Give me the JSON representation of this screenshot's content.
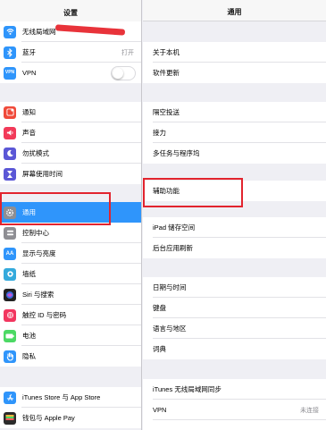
{
  "colors": {
    "accent": "#2f95fb",
    "annotation": "#e2242e",
    "wifi": "#2f95fb",
    "bluetooth": "#2f95fb",
    "vpn": "#2f95fb",
    "notifications": "#f04a3a",
    "sounds": "#f23a59",
    "dnd": "#5b57d6",
    "screen_time": "#5b57d6",
    "general": "#8e8e93",
    "control_center": "#8e8e93",
    "display": "#2f95fb",
    "wallpaper": "#34aadc",
    "siri": "#222222",
    "touchid": "#f2365f",
    "battery": "#4cd964",
    "privacy": "#2f95fb",
    "appstore": "#2f95fb",
    "wallet": "#2b2b2b"
  },
  "left": {
    "title": "设置",
    "items": [
      {
        "label": "无线局域网",
        "icon": "wifi-icon",
        "value": ""
      },
      {
        "label": "蓝牙",
        "icon": "bluetooth-icon",
        "value": "打开"
      },
      {
        "label": "VPN",
        "icon": "vpn-icon",
        "value": ""
      },
      {
        "label": "通知",
        "icon": "notification-icon",
        "value": ""
      },
      {
        "label": "声音",
        "icon": "sound-icon",
        "value": ""
      },
      {
        "label": "勿扰模式",
        "icon": "moon-icon",
        "value": ""
      },
      {
        "label": "屏幕使用时间",
        "icon": "hourglass-icon",
        "value": ""
      },
      {
        "label": "通用",
        "icon": "gear-icon",
        "value": ""
      },
      {
        "label": "控制中心",
        "icon": "control-center-icon",
        "value": ""
      },
      {
        "label": "显示与亮度",
        "icon": "display-icon",
        "value": ""
      },
      {
        "label": "墙纸",
        "icon": "wallpaper-icon",
        "value": ""
      },
      {
        "label": "Siri 与搜索",
        "icon": "siri-icon",
        "value": ""
      },
      {
        "label": "触控 ID 与密码",
        "icon": "fingerprint-icon",
        "value": ""
      },
      {
        "label": "电池",
        "icon": "battery-icon",
        "value": ""
      },
      {
        "label": "隐私",
        "icon": "hand-icon",
        "value": ""
      },
      {
        "label": "iTunes Store 与 App Store",
        "icon": "app-store-icon",
        "value": ""
      },
      {
        "label": "钱包与 Apple Pay",
        "icon": "wallet-icon",
        "value": ""
      }
    ]
  },
  "right": {
    "title": "通用",
    "items": [
      {
        "label": "关于本机",
        "value": ""
      },
      {
        "label": "软件更新",
        "value": ""
      },
      {
        "label": "隔空投送",
        "value": ""
      },
      {
        "label": "接力",
        "value": ""
      },
      {
        "label": "多任务与程序坞",
        "value": ""
      },
      {
        "label": "辅助功能",
        "value": ""
      },
      {
        "label": "iPad 储存空间",
        "value": ""
      },
      {
        "label": "后台应用刷新",
        "value": ""
      },
      {
        "label": "日期与时间",
        "value": ""
      },
      {
        "label": "键盘",
        "value": ""
      },
      {
        "label": "语言与地区",
        "value": ""
      },
      {
        "label": "词典",
        "value": ""
      },
      {
        "label": "iTunes 无线局域网同步",
        "value": ""
      },
      {
        "label": "VPN",
        "value": "未连接"
      }
    ]
  }
}
